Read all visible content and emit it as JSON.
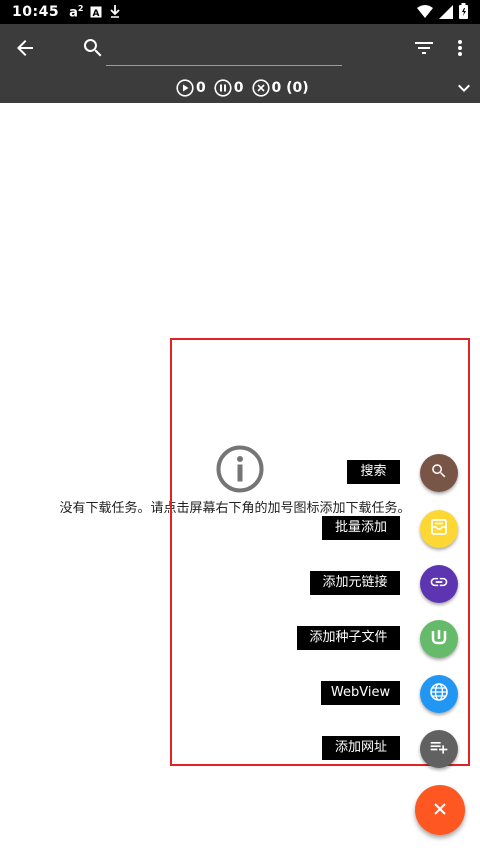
{
  "status_bar": {
    "time": "10:45",
    "notification_icons": [
      "a-squared-icon",
      "a-box-icon",
      "download-arrow-icon"
    ],
    "system_icons": [
      "wifi-icon",
      "cell-signal-icon",
      "battery-icon"
    ]
  },
  "toolbar": {
    "back_icon": "arrow-left-icon",
    "search_icon": "search-icon",
    "search_value": "",
    "search_placeholder": "",
    "filter_icon": "filter-icon",
    "more_icon": "more-vertical-icon",
    "expand_icon": "chevron-down-icon"
  },
  "counters": {
    "running": "0",
    "paused": "0",
    "error": "0 (0)"
  },
  "empty_state": {
    "icon": "info-icon",
    "message": "没有下载任务。请点击屏幕右下角的加号图标添加下载任务。"
  },
  "speed_dial": {
    "items": [
      {
        "label": "搜索",
        "icon": "search-icon",
        "color": "#795548"
      },
      {
        "label": "批量添加",
        "icon": "batch-add-icon",
        "color": "#fdd835"
      },
      {
        "label": "添加元链接",
        "icon": "link-icon",
        "color": "#5e35b1"
      },
      {
        "label": "添加种子文件",
        "icon": "utorrent-icon",
        "color": "#66bb6a"
      },
      {
        "label": "WebView",
        "icon": "globe-icon",
        "color": "#2196f3"
      },
      {
        "label": "添加网址",
        "icon": "playlist-add-icon",
        "color": "#616161"
      }
    ],
    "main_fab": {
      "icon": "close-icon",
      "color": "#ff5722"
    }
  },
  "colors": {
    "toolbar_bg": "#3c3c3c",
    "status_bar_bg": "#000000",
    "highlight_border": "#e52222",
    "label_bg": "#000000"
  }
}
